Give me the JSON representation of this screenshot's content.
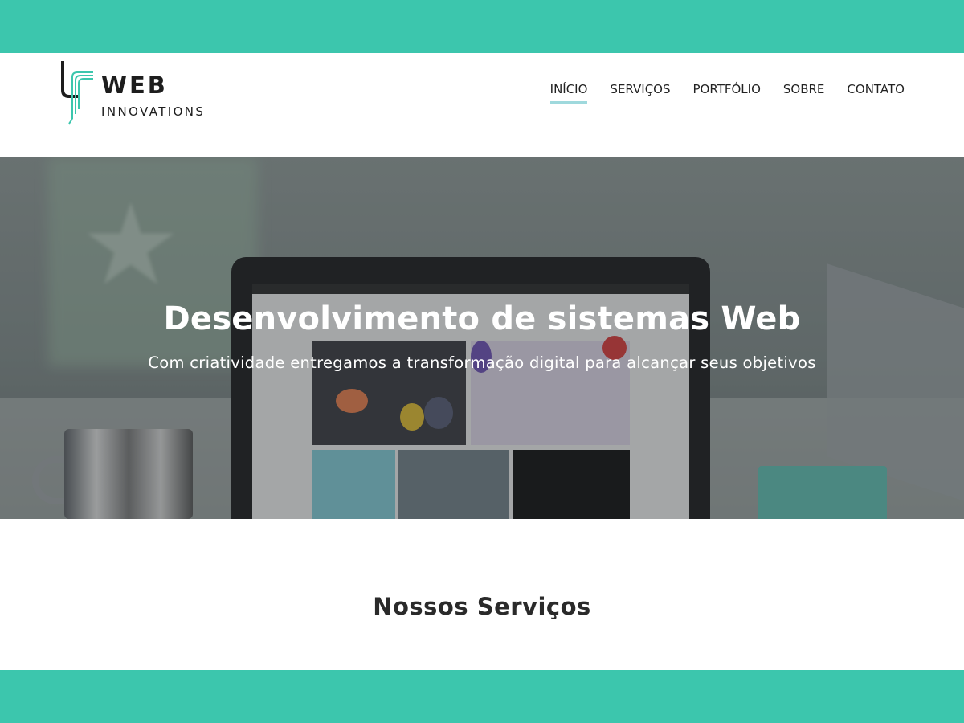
{
  "colors": {
    "accent": "#3cc6ad",
    "nav_underline": "#9fd9dd",
    "text_dark": "#1d1d1d"
  },
  "logo": {
    "title": "WEB",
    "subtitle": "INNOVATIONS",
    "icon": "wi-monogram-icon"
  },
  "nav": {
    "items": [
      {
        "label": "INÍCIO",
        "active": true
      },
      {
        "label": "SERVIÇOS",
        "active": false
      },
      {
        "label": "PORTFÓLIO",
        "active": false
      },
      {
        "label": "SOBRE",
        "active": false
      },
      {
        "label": "CONTATO",
        "active": false
      }
    ]
  },
  "hero": {
    "title": "Desenvolvimento de sistemas Web",
    "subtitle": "Com criatividade entregamos a transformação digital para alcançar seus objetivos"
  },
  "services": {
    "title": "Nossos Serviços"
  }
}
